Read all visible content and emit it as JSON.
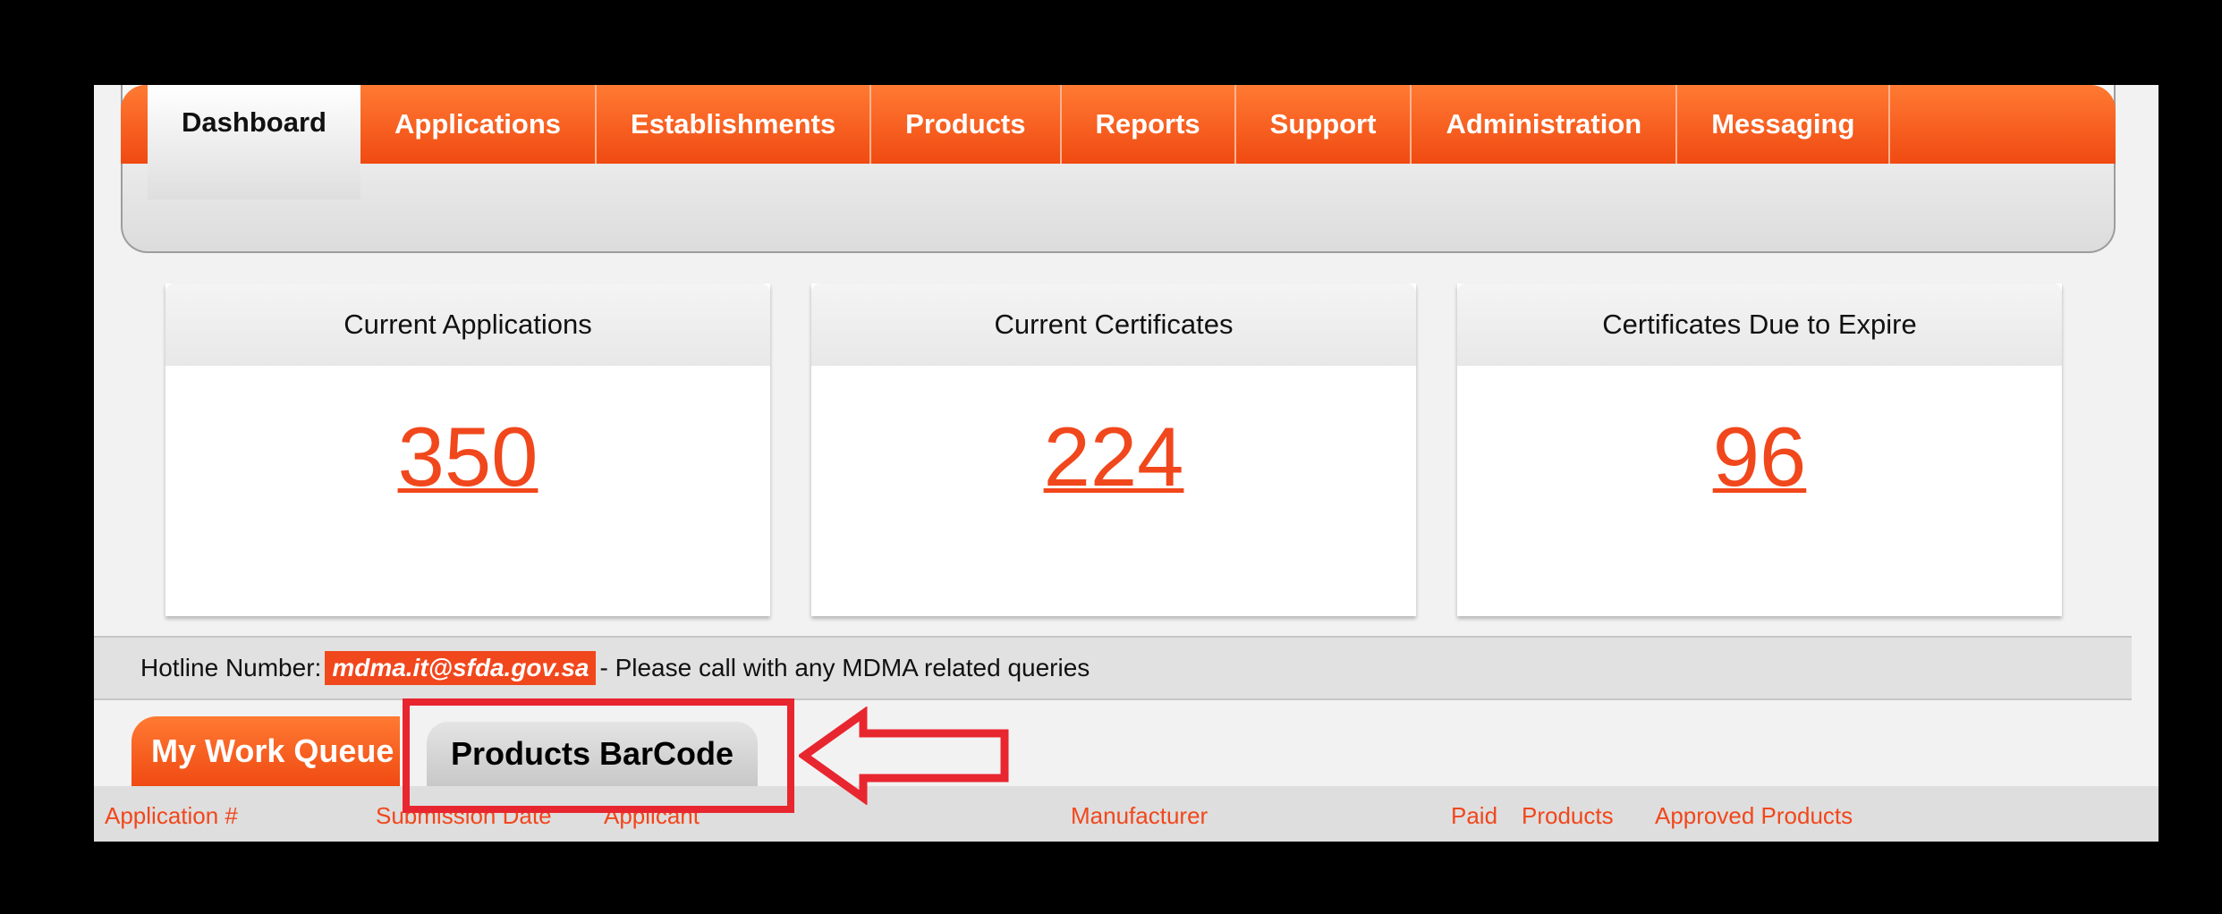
{
  "nav": {
    "tabs": [
      "Dashboard",
      "Applications",
      "Establishments",
      "Products",
      "Reports",
      "Support",
      "Administration",
      "Messaging"
    ],
    "active_index": 0
  },
  "stats": [
    {
      "title": "Current Applications",
      "value": "350"
    },
    {
      "title": "Current Certificates",
      "value": "224"
    },
    {
      "title": "Certificates Due to Expire",
      "value": "96"
    }
  ],
  "hotline": {
    "label": "Hotline Number:",
    "email": "mdma.it@sfda.gov.sa",
    "suffix": "- Please call with any MDMA related queries"
  },
  "queue_tabs": {
    "work_queue": "My Work Queue",
    "barcode": "Products BarCode"
  },
  "table": {
    "columns": [
      "Application #",
      "Submission Date",
      "Applicant",
      "Manufacturer",
      "Paid",
      "Products",
      "Approved Products"
    ]
  },
  "colors": {
    "accent": "#f1471c",
    "annotation": "#e8262f"
  }
}
